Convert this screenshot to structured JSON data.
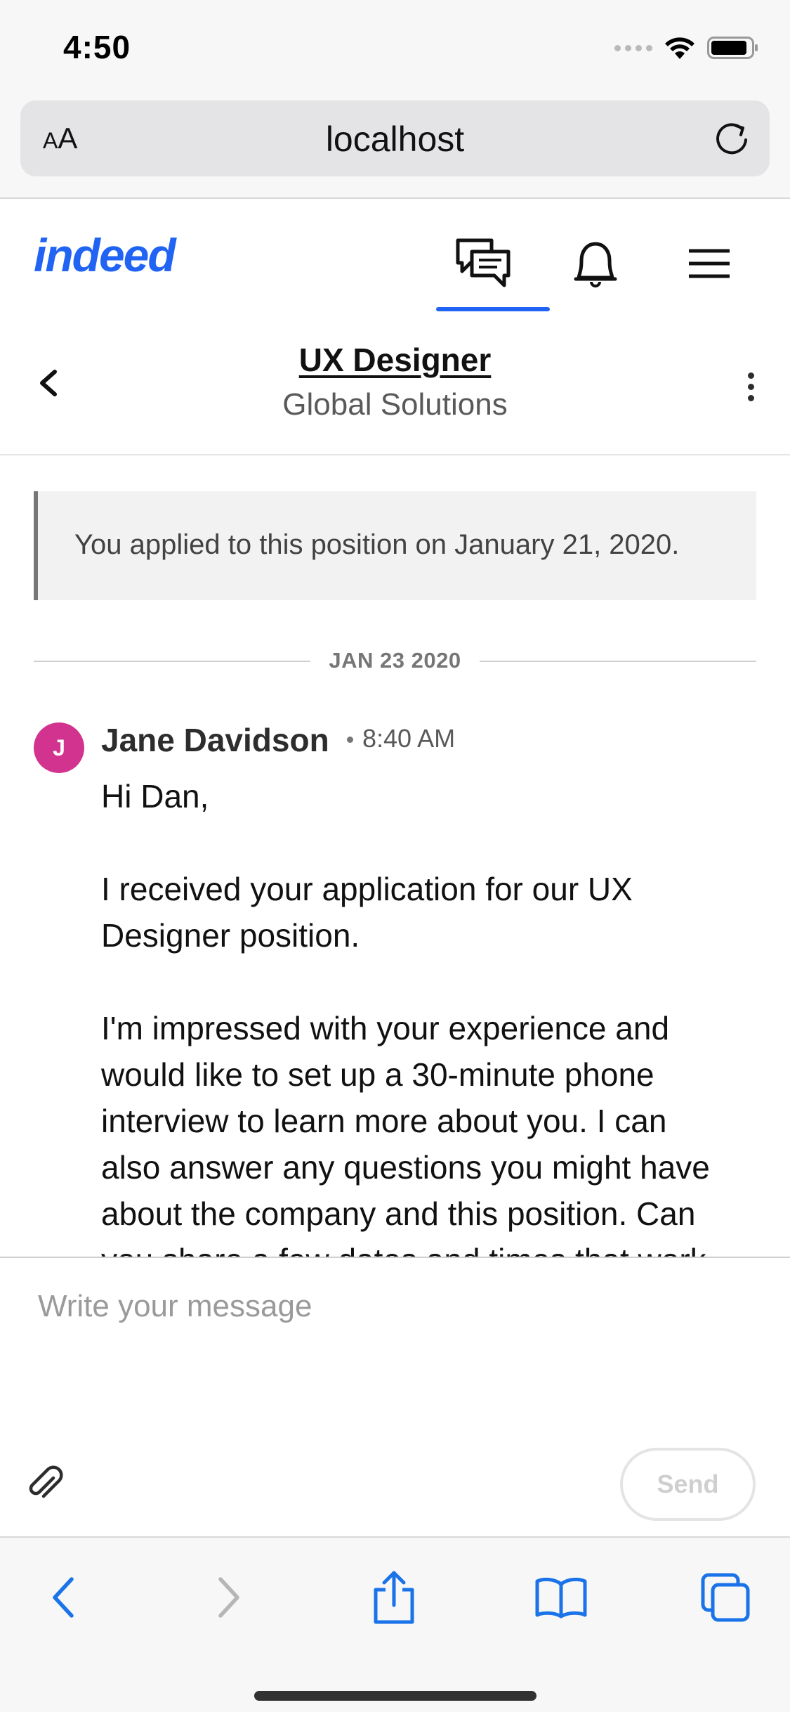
{
  "status_bar": {
    "time": "4:50"
  },
  "safari": {
    "text_size_label_small": "A",
    "text_size_label_large": "A",
    "url": "localhost"
  },
  "indeed_header": {
    "logo": "indeed",
    "nav": [
      {
        "icon": "messages-icon",
        "active": true
      },
      {
        "icon": "bell-icon",
        "active": false
      },
      {
        "icon": "menu-icon",
        "active": false
      }
    ],
    "accent_color": "#2164f3"
  },
  "job": {
    "title": "UX Designer",
    "company": "Global Solutions"
  },
  "conversation": {
    "applied_notice": "You applied to this position on January 21, 2020.",
    "date_divider": "JAN 23 2020",
    "message": {
      "avatar_initial": "J",
      "avatar_color": "#d1338f",
      "sender": "Jane Davidson",
      "time": "8:40 AM",
      "lines": [
        "Hi Dan,",
        "",
        "I received your application for our UX",
        "Designer position.",
        "",
        "I'm impressed with your experience and",
        "would like to set up a 30-minute phone",
        "interview to learn more about you. I can",
        "also answer any questions you might have",
        "about the company and this position. Can",
        "you share a few dates and times that work"
      ]
    }
  },
  "composer": {
    "placeholder": "Write your message",
    "send_label": "Send"
  },
  "safari_toolbar": {
    "buttons": [
      "back-icon",
      "forward-icon",
      "share-icon",
      "bookmarks-icon",
      "tabs-icon"
    ]
  }
}
